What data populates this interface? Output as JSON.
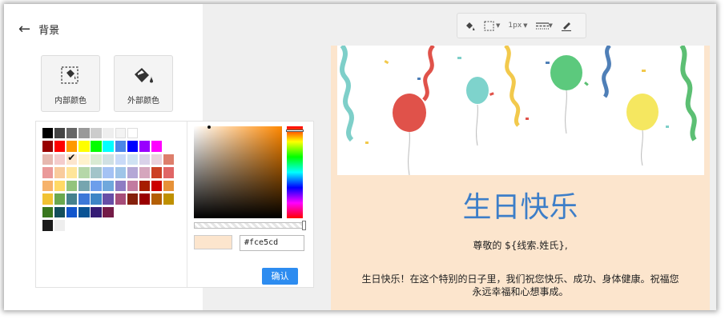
{
  "panel": {
    "title": "背景",
    "inner_label": "内部颜色",
    "outer_label": "外部颜色"
  },
  "swatches": [
    [
      "#000000",
      "#444444",
      "#666666",
      "#999999",
      "#cccccc",
      "#eeeeee",
      "#f3f3f3",
      "#ffffff"
    ],
    [
      "#980000",
      "#ff0000",
      "#ff9900",
      "#ffff00",
      "#00ff00",
      "#00ffff",
      "#4a86e8",
      "#0000ff",
      "#9900ff",
      "#ff00ff"
    ],
    [
      "#e6b8af",
      "#f4cccc",
      "#fce5cd",
      "#fff2cc",
      "#d9ead3",
      "#d0e0e3",
      "#c9daf8",
      "#cfe2f3",
      "#d9d2e9",
      "#ead1dc",
      "#dd7e6b"
    ],
    [
      "#ea9999",
      "#f9cb9c",
      "#ffe599",
      "#b6d7a8",
      "#a2c4c9",
      "#a4c2f4",
      "#9fc5e8",
      "#b4a7d6",
      "#d5a6bd",
      "#cc4125",
      "#e06666"
    ],
    [
      "#f6b26b",
      "#ffd966",
      "#93c47d",
      "#76a5af",
      "#6d9eeb",
      "#6fa8dc",
      "#8e7cc3",
      "#c27ba0",
      "#a61c00",
      "#cc0000",
      "#e69138"
    ],
    [
      "#f1c232",
      "#6aa84f",
      "#45818e",
      "#3c78d8",
      "#3d85c6",
      "#674ea7",
      "#a64d79",
      "#85200c",
      "#990000",
      "#b45f06",
      "#bf9000"
    ],
    [
      "#38761d",
      "#134f5c",
      "#1155cc",
      "#0b5394",
      "#351c75",
      "#741b47"
    ],
    [
      "#1a1a1a",
      "#eeeeee"
    ]
  ],
  "selected_swatch": "#fce5cd",
  "picker": {
    "hex_value": "#fce5cd",
    "confirm_label": "确认"
  },
  "toolbar": {
    "border_width": "1px"
  },
  "card": {
    "title": "生日快乐",
    "greeting": "尊敬的 ${线索.姓氏},",
    "body_line1": "生日快乐！在这个特别的日子里，我们祝您快乐、成功、身体健康。祝福您",
    "body_line2": "永远幸福和心想事成。",
    "background": "#fce5cd",
    "title_color": "#3d7ec8"
  }
}
